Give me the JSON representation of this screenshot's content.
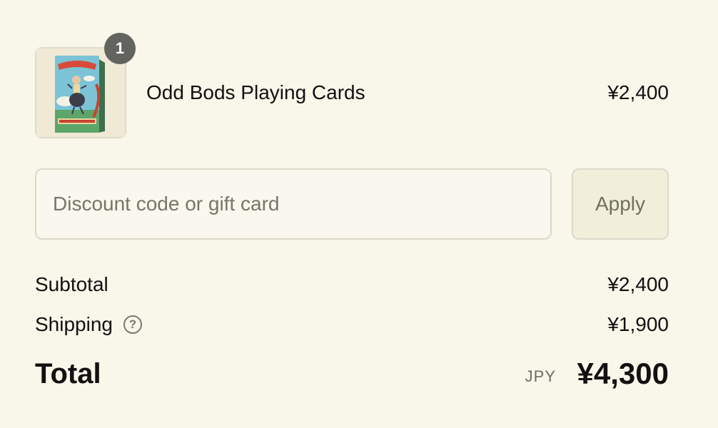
{
  "line_items": [
    {
      "name": "Odd Bods Playing Cards",
      "price": "¥2,400",
      "quantity": "1",
      "thumbnail_icon": "playing-card-box-image"
    }
  ],
  "discount": {
    "placeholder": "Discount code or gift card",
    "value": "",
    "apply_label": "Apply"
  },
  "totals": {
    "subtotal_label": "Subtotal",
    "subtotal_value": "¥2,400",
    "shipping_label": "Shipping",
    "shipping_help_icon": "question-circle-icon",
    "shipping_value": "¥1,900",
    "total_label": "Total",
    "currency_code": "JPY",
    "total_value": "¥4,300"
  },
  "colors": {
    "background": "#f9f6ea",
    "badge": "#636360",
    "apply_button_bg": "#f1efd9",
    "border": "#dcd9c9"
  }
}
